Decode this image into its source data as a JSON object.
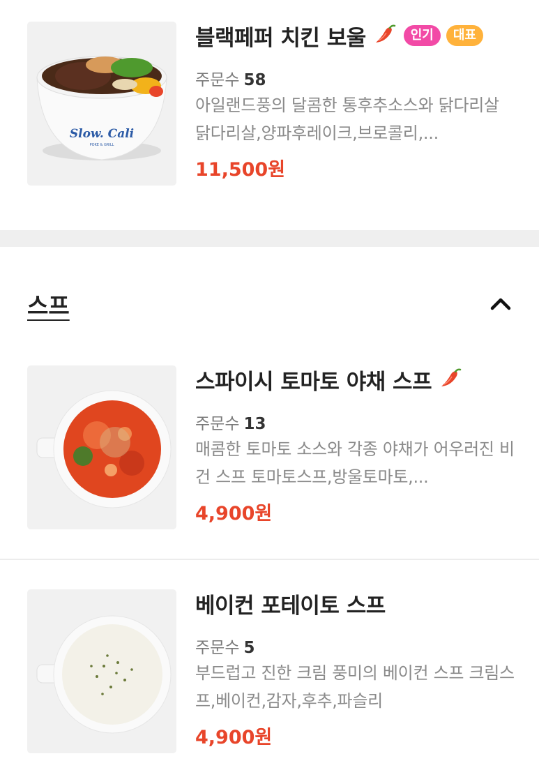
{
  "items_top": [
    {
      "title": "블랙페퍼 치킨 보울",
      "badges": [
        "인기",
        "대표"
      ],
      "orders_label": "주문수",
      "orders": "58",
      "description": "아일랜드풍의 달콤한 통후추소스와 닭다리살 닭다리살,양파후레이크,브로콜리,...",
      "price": "11,500원",
      "image_brand": "Slow. Cali",
      "image_brand_sub": "POKE & GRILL"
    }
  ],
  "soup_section": {
    "title": "스프",
    "items": [
      {
        "title": "스파이시 토마토 야채 스프",
        "orders_label": "주문수",
        "orders": "13",
        "description": "매콤한 토마토 소스와 각종 야채가 어우러진 비건 스프 토마토스프,방울토마토,...",
        "price": "4,900원"
      },
      {
        "title": "베이컨 포테이토 스프",
        "orders_label": "주문수",
        "orders": "5",
        "description": "부드럽고 진한 크림 풍미의 베이컨 스프 크림스프,베이컨,감자,후추,파슬리",
        "price": "4,900원"
      }
    ]
  },
  "colors": {
    "price": "#e8452a",
    "badge_popular": "#f24aa6",
    "badge_signature": "#ffb23b",
    "section_gap": "#efefef"
  },
  "icons": {
    "spicy": "chili-pepper-icon",
    "collapse": "chevron-up-icon"
  }
}
